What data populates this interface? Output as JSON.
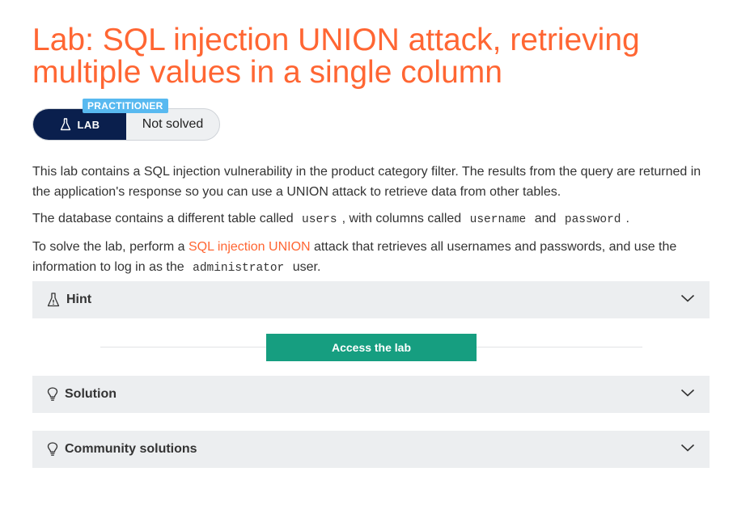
{
  "header": {
    "title": "Lab: SQL injection UNION attack, retrieving multiple values in a single column"
  },
  "lab_widget": {
    "level": "PRACTITIONER",
    "lab_label": "LAB",
    "status": "Not solved"
  },
  "description": {
    "p1": "This lab contains a SQL injection vulnerability in the product category filter. The results from the query are returned in the application's response so you can use a UNION attack to retrieve data from other tables.",
    "p2_a": "The database contains a different table called",
    "p2_code1": "users",
    "p2_b": ", with columns called",
    "p2_code2": "username",
    "p2_c": "and",
    "p2_code3": "password",
    "p2_d": ".",
    "p3_a": "To solve the lab, perform a",
    "p3_link": "SQL injection UNION",
    "p3_b": "attack that retrieves all usernames and passwords, and use the information to log in as the",
    "p3_code": "administrator",
    "p3_c": "user."
  },
  "sections": {
    "hint": "Hint",
    "access_button": "Access the lab",
    "solution": "Solution",
    "community": "Community solutions"
  },
  "icons": {
    "lab": "flask-icon",
    "hint": "warning-flask-icon",
    "solution": "lightbulb-icon",
    "community": "lightbulb-icon",
    "chevron": "chevron-down-icon"
  },
  "colors": {
    "accent": "#ff6633",
    "lab_bg": "#0a1f4d",
    "badge": "#58b9f0",
    "button": "#169e80"
  }
}
